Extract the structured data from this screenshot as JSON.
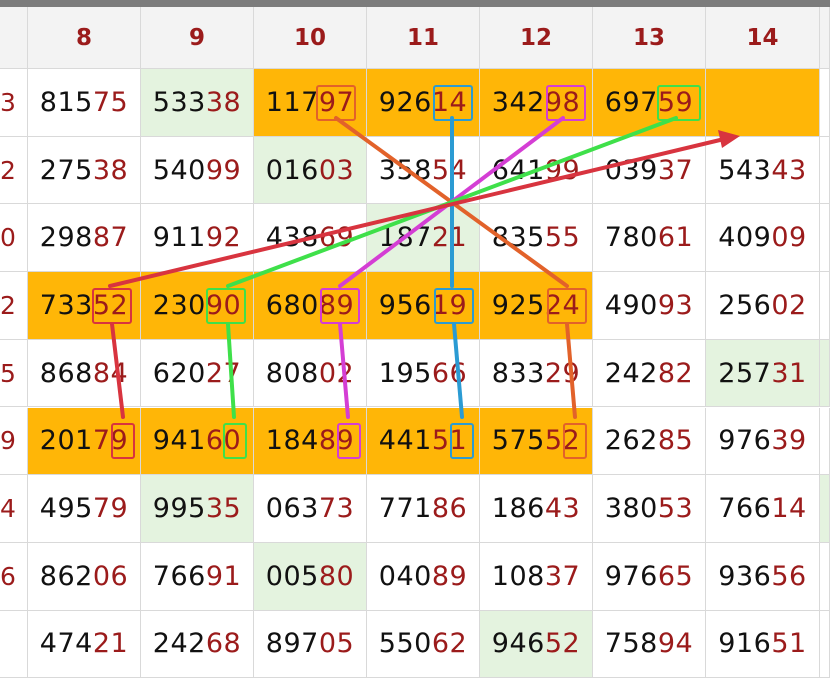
{
  "columns": [
    "",
    "8",
    "9",
    "10",
    "11",
    "12",
    "13",
    "14"
  ],
  "rows": [
    {
      "label": "3",
      "cells": [
        "81575",
        "53338",
        "11797",
        "92614",
        "34298",
        "69759",
        ""
      ]
    },
    {
      "label": "2",
      "cells": [
        "27538",
        "54099",
        "01603",
        "35854",
        "64199",
        "03937",
        "54343"
      ]
    },
    {
      "label": "0",
      "cells": [
        "29887",
        "91192",
        "43869",
        "18721",
        "83555",
        "78061",
        "40909"
      ]
    },
    {
      "label": "2",
      "cells": [
        "73352",
        "23090",
        "68089",
        "95619",
        "92524",
        "49093",
        "25602"
      ]
    },
    {
      "label": "5",
      "cells": [
        "86884",
        "62027",
        "80802",
        "19566",
        "83329",
        "24282",
        "25731"
      ]
    },
    {
      "label": "9",
      "cells": [
        "20179",
        "94160",
        "18489",
        "44151",
        "57552",
        "26285",
        "97639"
      ]
    },
    {
      "label": "4",
      "cells": [
        "49579",
        "99535",
        "06373",
        "77186",
        "18643",
        "38053",
        "76614"
      ]
    },
    {
      "label": "6",
      "cells": [
        "86206",
        "76691",
        "00580",
        "04089",
        "10837",
        "97665",
        "93656"
      ]
    },
    {
      "label": "",
      "cells": [
        "47421",
        "24268",
        "89705",
        "55062",
        "94652",
        "75894",
        "91651"
      ]
    }
  ],
  "colors": {
    "highlight": "#ffb607",
    "green_cell": "#e4f3df",
    "digit_dark": "#111111",
    "digit_red": "#9b1b1b",
    "line_orange": "#e2622a",
    "line_blue": "#2b9bd3",
    "line_magenta": "#d43ed4",
    "line_green": "#3fe04a",
    "line_red": "#d8343f"
  }
}
